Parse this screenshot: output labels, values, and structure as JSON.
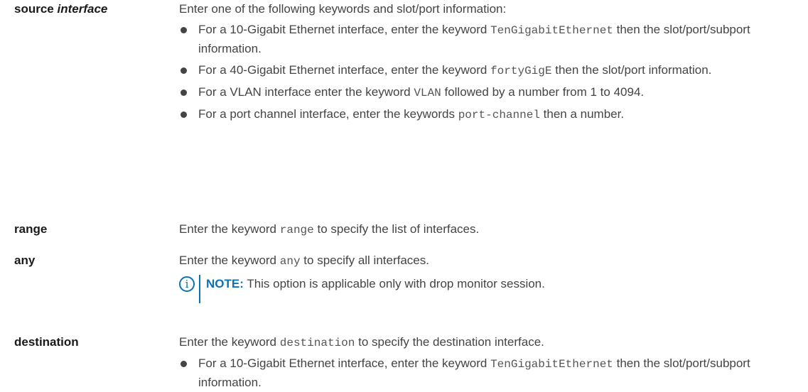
{
  "rows": {
    "source": {
      "term_word": "source",
      "term_param": "interface",
      "intro": "Enter one of the following keywords and slot/port information:",
      "bullets": [
        {
          "a": "For a 10-Gigabit Ethernet interface, enter the keyword",
          "code": "TenGigabitEthernet",
          "b": "then the slot/port/subport information."
        },
        {
          "a": "For a 40-Gigabit Ethernet interface, enter the keyword",
          "code": "fortyGigE",
          "b": "then the slot/port information."
        },
        {
          "a": "For a VLAN interface enter the keyword",
          "code": "VLAN",
          "b": "followed by a number from 1 to 4094."
        },
        {
          "a": "For a port channel interface, enter the keywords",
          "code": "port-channel",
          "b": "then a number."
        }
      ]
    },
    "range": {
      "term": "range",
      "a": "Enter the keyword",
      "code": "range",
      "b": "to specify the list of interfaces."
    },
    "any": {
      "term": "any",
      "a": "Enter the keyword",
      "code": "any",
      "b": "to specify all interfaces.",
      "note_label": "NOTE:",
      "note_text": "This option is applicable only with drop monitor session."
    },
    "destination": {
      "term": "destination",
      "a": "Enter the keyword",
      "code": "destination",
      "b": "to specify the destination interface.",
      "bullets": [
        {
          "a": "For a 10-Gigabit Ethernet interface, enter the keyword",
          "code": "TenGigabitEthernet",
          "b": "then the slot/port/subport information."
        }
      ]
    }
  },
  "colors": {
    "text": "#444444",
    "term": "#1a1a1a",
    "note_accent": "#0a72b8"
  },
  "icons": {
    "note": "info-circle-icon"
  }
}
